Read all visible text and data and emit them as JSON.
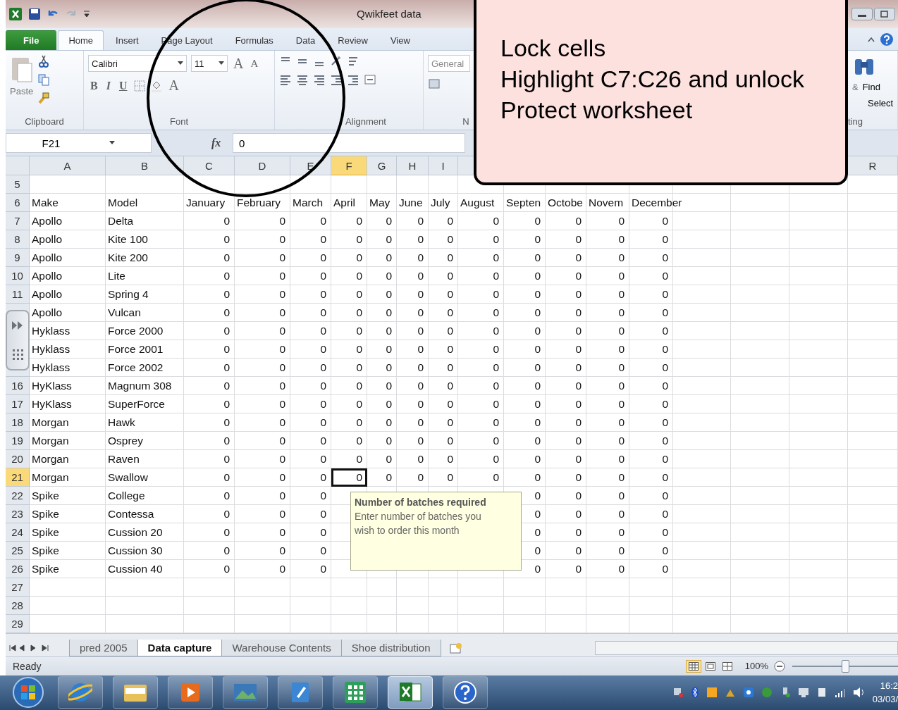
{
  "title_bar": {
    "title": "Qwikfeet data"
  },
  "ribbon_tabs": [
    {
      "label": "File",
      "kind": "file",
      "selected": false
    },
    {
      "label": "Home",
      "kind": "tab",
      "selected": true
    },
    {
      "label": "Insert",
      "kind": "tab",
      "selected": false
    },
    {
      "label": "Page Layout",
      "kind": "tab",
      "selected": false
    },
    {
      "label": "Formulas",
      "kind": "tab",
      "selected": false
    },
    {
      "label": "Data",
      "kind": "tab",
      "selected": false
    },
    {
      "label": "Review",
      "kind": "tab",
      "selected": false
    },
    {
      "label": "View",
      "kind": "tab",
      "selected": false
    }
  ],
  "ribbon": {
    "paste": "Paste",
    "clipboard_group": "Clipboard",
    "font_name": "Calibri",
    "font_size": "11",
    "grow_font": "A",
    "shrink_font": "A",
    "bold": "B",
    "italic": "I",
    "underline": "U",
    "font_color": "A",
    "font_group": "Font",
    "alignment_group": "Alignment",
    "number_format": "General",
    "number_group": "N",
    "ampersand": "&",
    "find": "Find",
    "select": "Select",
    "editing_group": "ting"
  },
  "formula_bar": {
    "name_box": "F21",
    "function_label": "fx",
    "value": "0"
  },
  "columns": [
    {
      "label": "A",
      "selected": false
    },
    {
      "label": "B",
      "selected": false
    },
    {
      "label": "C",
      "selected": false
    },
    {
      "label": "D",
      "selected": false
    },
    {
      "label": "E",
      "selected": false
    },
    {
      "label": "F",
      "selected": true
    },
    {
      "label": "G",
      "selected": false
    },
    {
      "label": "H",
      "selected": false
    },
    {
      "label": "I",
      "selected": false
    },
    {
      "label": "R",
      "selected": false
    }
  ],
  "rows": [
    {
      "number": "5",
      "kind": "blank",
      "selected": false
    },
    {
      "number": "6",
      "kind": "header",
      "selected": false,
      "make": "Make",
      "model": "Model",
      "values": [
        "January",
        "February",
        "March",
        "April",
        "May",
        "June",
        "July",
        "August",
        "Septen",
        "Octobe",
        "Novem",
        "December"
      ]
    },
    {
      "number": "7",
      "kind": "data",
      "selected": false,
      "make": "Apollo",
      "model": "Delta",
      "values": [
        "0",
        "0",
        "0",
        "0",
        "0",
        "0",
        "0",
        "0",
        "0",
        "0",
        "0",
        "0"
      ]
    },
    {
      "number": "8",
      "kind": "data",
      "selected": false,
      "make": "Apollo",
      "model": "Kite 100",
      "values": [
        "0",
        "0",
        "0",
        "0",
        "0",
        "0",
        "0",
        "0",
        "0",
        "0",
        "0",
        "0"
      ]
    },
    {
      "number": "9",
      "kind": "data",
      "selected": false,
      "make": "Apollo",
      "model": "Kite 200",
      "values": [
        "0",
        "0",
        "0",
        "0",
        "0",
        "0",
        "0",
        "0",
        "0",
        "0",
        "0",
        "0"
      ]
    },
    {
      "number": "10",
      "kind": "data",
      "selected": false,
      "make": "Apollo",
      "model": "Lite",
      "values": [
        "0",
        "0",
        "0",
        "0",
        "0",
        "0",
        "0",
        "0",
        "0",
        "0",
        "0",
        "0"
      ]
    },
    {
      "number": "11",
      "kind": "data",
      "selected": false,
      "make": "Apollo",
      "model": "Spring 4",
      "values": [
        "0",
        "0",
        "0",
        "0",
        "0",
        "0",
        "0",
        "0",
        "0",
        "0",
        "0",
        "0"
      ]
    },
    {
      "kind": "data",
      "selected": false,
      "make": "Apollo",
      "model": "Vulcan",
      "values": [
        "0",
        "0",
        "0",
        "0",
        "0",
        "0",
        "0",
        "0",
        "0",
        "0",
        "0",
        "0"
      ]
    },
    {
      "kind": "data",
      "selected": false,
      "make": "Hyklass",
      "model": "Force 2000",
      "values": [
        "0",
        "0",
        "0",
        "0",
        "0",
        "0",
        "0",
        "0",
        "0",
        "0",
        "0",
        "0"
      ]
    },
    {
      "kind": "data",
      "selected": false,
      "make": "Hyklass",
      "model": "Force 2001",
      "values": [
        "0",
        "0",
        "0",
        "0",
        "0",
        "0",
        "0",
        "0",
        "0",
        "0",
        "0",
        "0"
      ]
    },
    {
      "kind": "data",
      "selected": false,
      "make": "Hyklass",
      "model": "Force 2002",
      "values": [
        "0",
        "0",
        "0",
        "0",
        "0",
        "0",
        "0",
        "0",
        "0",
        "0",
        "0",
        "0"
      ]
    },
    {
      "number": "16",
      "kind": "data",
      "selected": false,
      "make": "HyKlass",
      "model": "Magnum 308",
      "values": [
        "0",
        "0",
        "0",
        "0",
        "0",
        "0",
        "0",
        "0",
        "0",
        "0",
        "0",
        "0"
      ]
    },
    {
      "number": "17",
      "kind": "data",
      "selected": false,
      "make": "HyKlass",
      "model": "SuperForce",
      "values": [
        "0",
        "0",
        "0",
        "0",
        "0",
        "0",
        "0",
        "0",
        "0",
        "0",
        "0",
        "0"
      ]
    },
    {
      "number": "18",
      "kind": "data",
      "selected": false,
      "make": "Morgan",
      "model": "Hawk",
      "values": [
        "0",
        "0",
        "0",
        "0",
        "0",
        "0",
        "0",
        "0",
        "0",
        "0",
        "0",
        "0"
      ]
    },
    {
      "number": "19",
      "kind": "data",
      "selected": false,
      "make": "Morgan",
      "model": "Osprey",
      "values": [
        "0",
        "0",
        "0",
        "0",
        "0",
        "0",
        "0",
        "0",
        "0",
        "0",
        "0",
        "0"
      ]
    },
    {
      "number": "20",
      "kind": "data",
      "selected": false,
      "make": "Morgan",
      "model": "Raven",
      "values": [
        "0",
        "0",
        "0",
        "0",
        "0",
        "0",
        "0",
        "0",
        "0",
        "0",
        "0",
        "0"
      ]
    },
    {
      "number": "21",
      "kind": "data",
      "selected": true,
      "make": "Morgan",
      "model": "Swallow",
      "values": [
        "0",
        "0",
        "0",
        "0",
        "0",
        "0",
        "0",
        "0",
        "0",
        "0",
        "0",
        "0"
      ]
    },
    {
      "number": "22",
      "kind": "data",
      "selected": false,
      "make": "Spike",
      "model": "College",
      "values": [
        "0",
        "0",
        "0"
      ],
      "values_after_tooltip": [
        "0",
        "0",
        "0",
        "0"
      ]
    },
    {
      "number": "23",
      "kind": "data",
      "selected": false,
      "make": "Spike",
      "model": "Contessa",
      "values": [
        "0",
        "0",
        "0"
      ],
      "values_after_tooltip": [
        "0",
        "0",
        "0",
        "0"
      ]
    },
    {
      "number": "24",
      "kind": "data",
      "selected": false,
      "make": "Spike",
      "model": "Cussion 20",
      "values": [
        "0",
        "0",
        "0"
      ],
      "values_after_tooltip": [
        "0",
        "0",
        "0",
        "0"
      ]
    },
    {
      "number": "25",
      "kind": "data",
      "selected": false,
      "make": "Spike",
      "model": "Cussion 30",
      "values": [
        "0",
        "0",
        "0"
      ],
      "values_after_tooltip": [
        "0",
        "0",
        "0",
        "0"
      ]
    },
    {
      "number": "26",
      "kind": "data",
      "selected": false,
      "make": "Spike",
      "model": "Cussion 40",
      "values": [
        "0",
        "0",
        "0"
      ],
      "values_after_tooltip": [
        "0",
        "0",
        "0",
        "0"
      ]
    },
    {
      "number": "27",
      "kind": "blank",
      "selected": false
    },
    {
      "number": "28",
      "kind": "blank",
      "selected": false
    },
    {
      "number": "29",
      "kind": "blank",
      "selected": false
    }
  ],
  "tooltip": {
    "title": "Number of batches required",
    "text": "Enter number of batches you wish to order this month"
  },
  "callout": {
    "lines": [
      "Lock cells",
      "Highlight C7:C26 and unlock",
      "Protect worksheet"
    ]
  },
  "sheet_tabs": [
    {
      "label": "pred 2005",
      "selected": false
    },
    {
      "label": "Data capture",
      "selected": true
    },
    {
      "label": "Warehouse Contents",
      "selected": false
    },
    {
      "label": "Shoe distribution",
      "selected": false
    }
  ],
  "status_bar": {
    "text": "Ready",
    "views": [
      {
        "kind": "normal",
        "selected": true
      },
      {
        "kind": "page-layout",
        "selected": false
      },
      {
        "kind": "page-break",
        "selected": false
      }
    ],
    "zoom": "100%",
    "zoom_slider": {
      "level": 0.5
    }
  },
  "taskbar": {
    "apps": [
      {
        "kind": "browser",
        "active": false
      },
      {
        "kind": "folder",
        "active": false
      },
      {
        "kind": "media",
        "active": false
      },
      {
        "kind": "photos",
        "active": false
      },
      {
        "kind": "notes",
        "active": false
      },
      {
        "kind": "grid",
        "active": false
      },
      {
        "kind": "spreadsheet",
        "active": true
      },
      {
        "kind": "help",
        "active": false
      }
    ],
    "time": "16:2",
    "date": "03/03/"
  }
}
